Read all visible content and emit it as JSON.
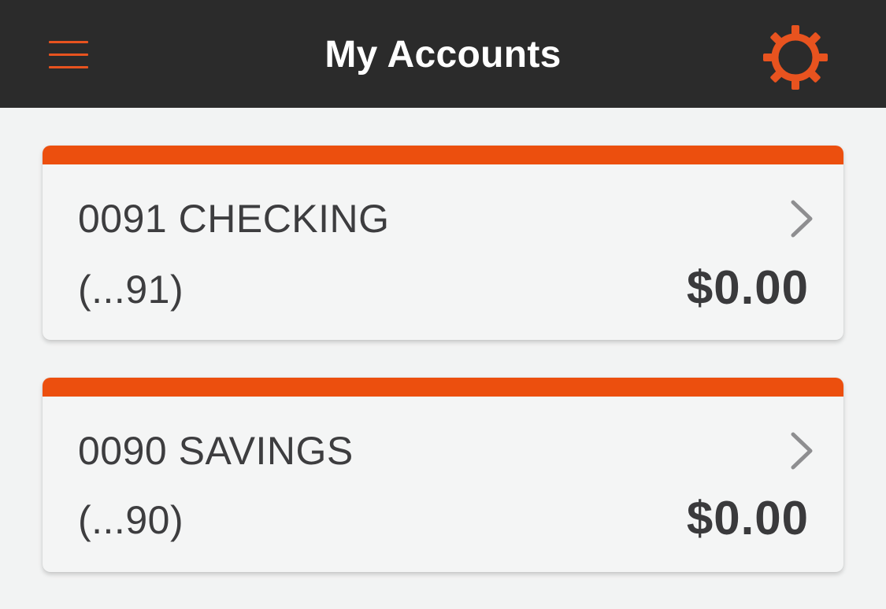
{
  "header": {
    "title": "My Accounts",
    "menu_icon": "hamburger-menu-icon",
    "settings_icon": "gear-icon",
    "background_color": "#2b2b2b",
    "accent_color": "#e8531f"
  },
  "accounts": [
    {
      "name": "0091 CHECKING",
      "masked_number": "(...91)",
      "balance": "$0.00",
      "chevron_icon": "chevron-right-icon"
    },
    {
      "name": "0090 SAVINGS",
      "masked_number": "(...90)",
      "balance": "$0.00",
      "chevron_icon": "chevron-right-icon"
    }
  ],
  "colors": {
    "card_accent": "#ec4f0e",
    "page_background": "#f2f3f3",
    "text": "#3d3d3f",
    "chevron": "#8e8e90"
  }
}
